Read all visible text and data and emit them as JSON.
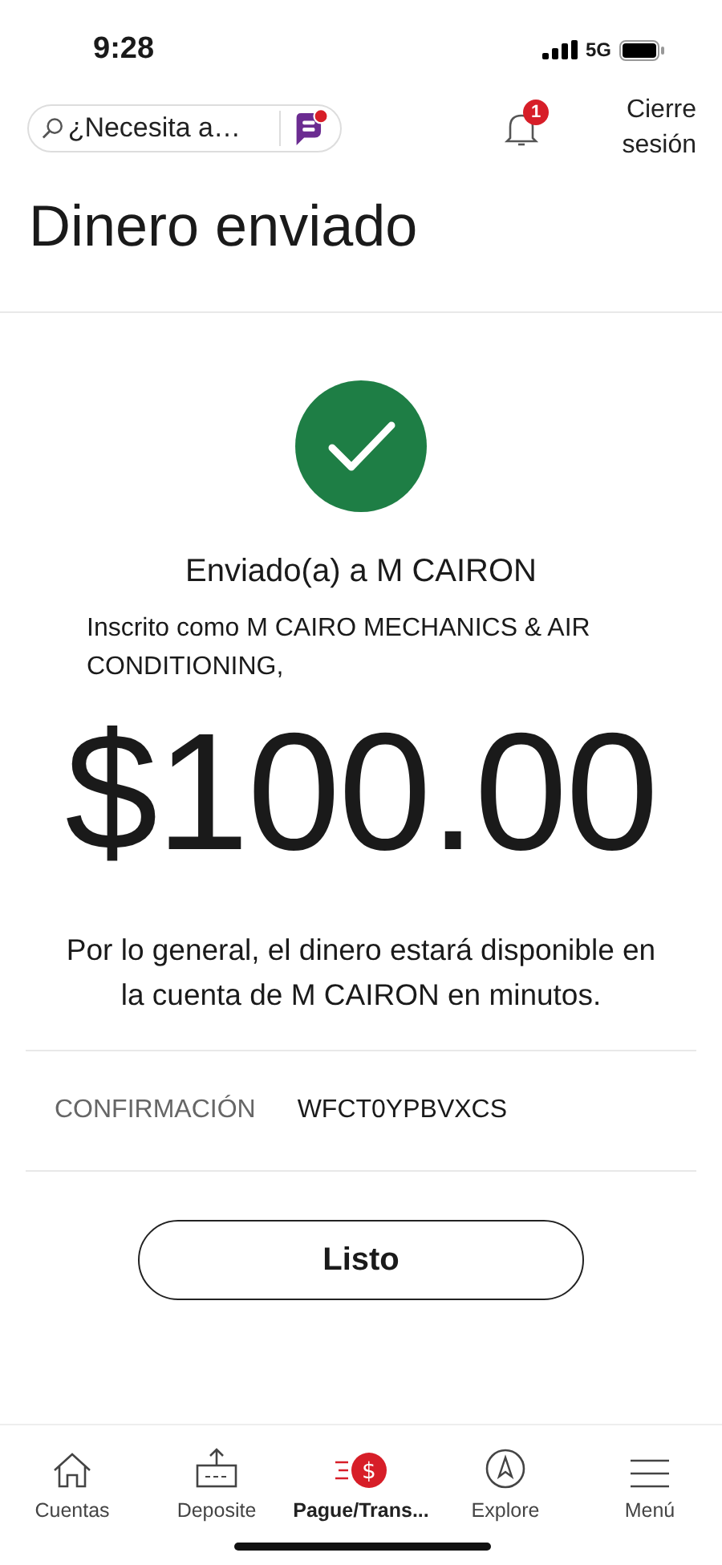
{
  "status_bar": {
    "time": "9:28",
    "network": "5G"
  },
  "header": {
    "search": {
      "placeholder": "¿Necesita a…"
    },
    "notifications": {
      "badge": "1"
    },
    "logout": "Cierre sesión"
  },
  "title": "Dinero enviado",
  "result": {
    "heading": "Enviado(a) a M CAIRON",
    "registered_as": "Inscrito como M CAIRO MECHANICS & AIR CONDITIONING,",
    "amount": "$100.00",
    "note": "Por lo general, el dinero estará disponible en la cuenta de M CAIRON en minutos."
  },
  "confirmation": {
    "label": "CONFIRMACIÓN",
    "value": "WFCT0YPBVXCS"
  },
  "done_button": "Listo",
  "nav": [
    {
      "label": "Cuentas",
      "selected": false
    },
    {
      "label": "Deposite",
      "selected": false
    },
    {
      "label": "Pague/Trans...",
      "selected": true,
      "icon_text": "$"
    },
    {
      "label": "Explore",
      "selected": false
    },
    {
      "label": "Menú",
      "selected": false
    }
  ]
}
